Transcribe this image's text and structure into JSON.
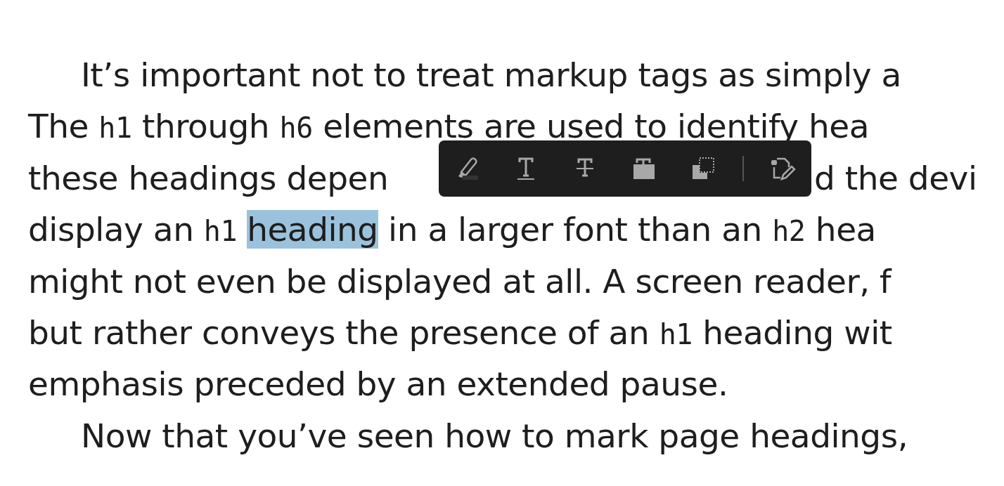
{
  "lines": [
    {
      "indent": true,
      "segments": [
        {
          "kind": "text",
          "text": "It’s important not to treat markup tags as simply a"
        }
      ]
    },
    {
      "indent": false,
      "segments": [
        {
          "kind": "text",
          "text": "The "
        },
        {
          "kind": "code",
          "text": "h1"
        },
        {
          "kind": "text",
          "text": " through "
        },
        {
          "kind": "code",
          "text": "h6"
        },
        {
          "kind": "text",
          "text": " elements are used to identify hea"
        }
      ]
    },
    {
      "indent": false,
      "segments": [
        {
          "kind": "text",
          "text": "these headings depen"
        }
      ],
      "after_toolbar": "d the devi"
    },
    {
      "indent": false,
      "segments": [
        {
          "kind": "text",
          "text": "display an "
        },
        {
          "kind": "code",
          "text": "h1"
        },
        {
          "kind": "selected",
          "text": "heading"
        },
        {
          "kind": "text",
          "text": " in a larger font than an "
        },
        {
          "kind": "code",
          "text": "h2"
        },
        {
          "kind": "text",
          "text": " hea"
        }
      ]
    },
    {
      "indent": false,
      "segments": [
        {
          "kind": "text",
          "text": "might not even be displayed at all. A screen reader, f"
        }
      ]
    },
    {
      "indent": false,
      "segments": [
        {
          "kind": "text",
          "text": "but rather conveys the presence of an "
        },
        {
          "kind": "code",
          "text": "h1"
        },
        {
          "kind": "text",
          "text": " heading wit"
        }
      ]
    },
    {
      "indent": false,
      "segments": [
        {
          "kind": "text",
          "text": "emphasis preceded by an extended pause."
        }
      ]
    },
    {
      "indent": true,
      "segments": [
        {
          "kind": "text",
          "text": "Now that you’ve seen how to mark page headings,"
        }
      ]
    }
  ],
  "toolbar": {
    "tools": [
      {
        "kind": "highlight"
      },
      {
        "kind": "underline"
      },
      {
        "kind": "strike"
      },
      {
        "kind": "fill"
      },
      {
        "kind": "copy"
      },
      {
        "kind": "divider"
      },
      {
        "kind": "note"
      }
    ]
  }
}
